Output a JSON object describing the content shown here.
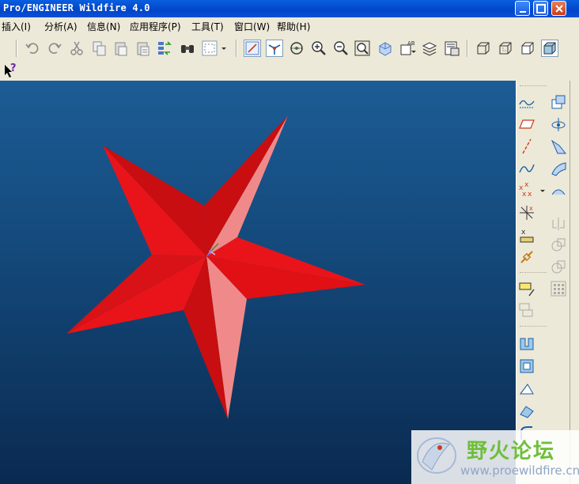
{
  "window": {
    "title": "Pro/ENGINEER Wildfire 4.0",
    "controls": [
      "minimize",
      "maximize",
      "close"
    ]
  },
  "menubar": {
    "items": [
      "插入(I)",
      "分析(A)",
      "信息(N)",
      "应用程序(P)",
      "工具(T)",
      "窗口(W)",
      "帮助(H)"
    ]
  },
  "toolbar": {
    "icons": [
      "undo-icon",
      "redo-icon",
      "cut-icon",
      "copy-icon",
      "paste-icon",
      "paste-special-icon",
      "regenerate-icon",
      "find-icon",
      "select-box-icon",
      "repaint-icon",
      "spin-center-icon",
      "orient-mode-icon",
      "zoom-in-icon",
      "zoom-out-icon",
      "refit-icon",
      "reorient-icon",
      "saved-views-icon",
      "layers-icon",
      "view-manager-icon",
      "wireframe-icon",
      "hidden-line-icon",
      "no-hidden-icon",
      "shading-icon"
    ]
  },
  "help": {
    "context_help": "?"
  },
  "watermark": {
    "brand": "野火论坛",
    "url": "www.proewildfire.cn"
  },
  "colors": {
    "star_face_dark": "#C80E10",
    "star_face_mid": "#E8141A",
    "star_face_light": "#F08A8A",
    "viewport_top": "#1C5C95",
    "viewport_bottom": "#0A2A50"
  }
}
